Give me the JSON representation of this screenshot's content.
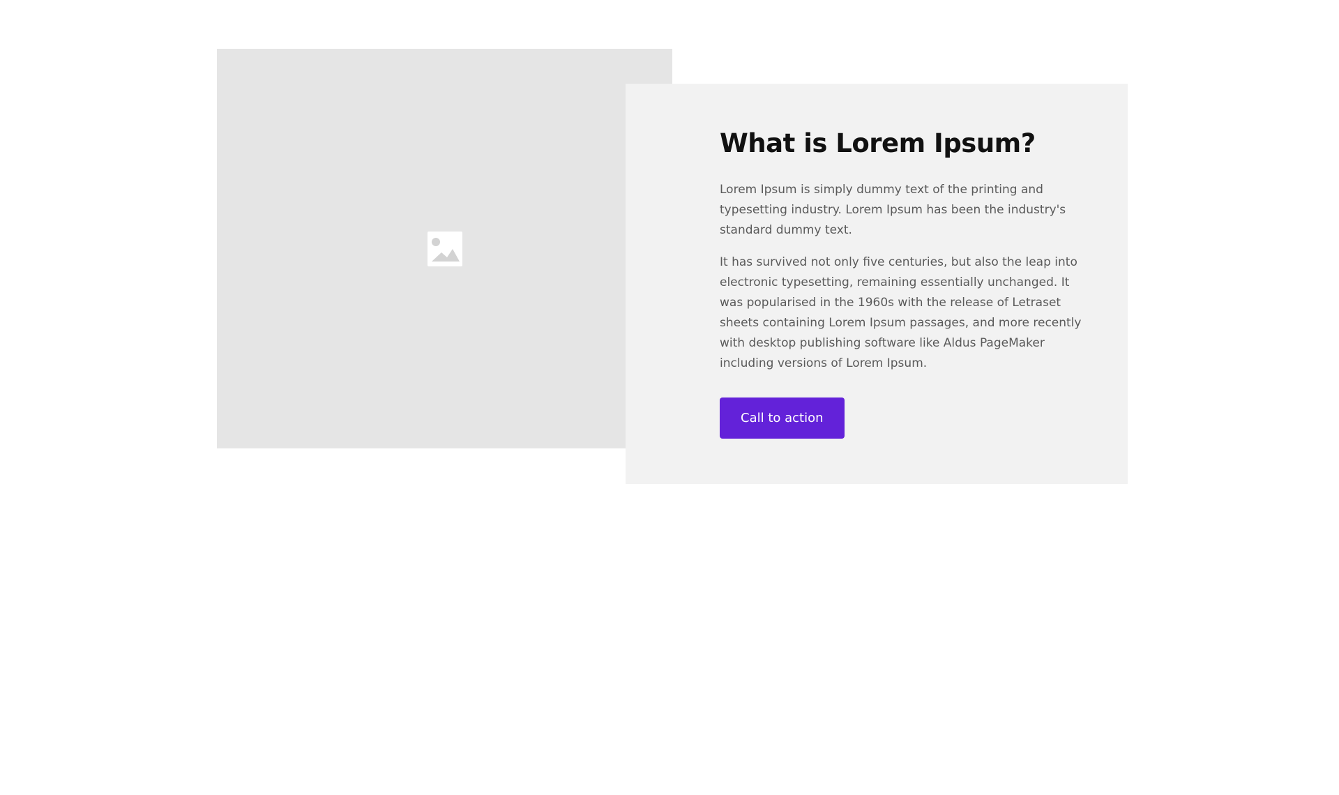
{
  "hero": {
    "image": {
      "icon": "image-placeholder-icon",
      "background_color": "#e5e5e5"
    },
    "card": {
      "background_color": "#f2f2f2",
      "heading": "What is Lorem Ipsum?",
      "paragraphs": [
        "Lorem Ipsum is simply dummy text of the printing and typesetting industry. Lorem Ipsum has been the industry's standard dummy text.",
        "It has survived not only five centuries, but also the leap into electronic typesetting, remaining essentially unchanged. It was popularised in the 1960s with the release of Letraset sheets containing Lorem Ipsum passages, and more recently with desktop publishing software like Aldus PageMaker including versions of Lorem Ipsum."
      ],
      "cta_label": "Call to action",
      "cta_color": "#6322d9"
    }
  }
}
